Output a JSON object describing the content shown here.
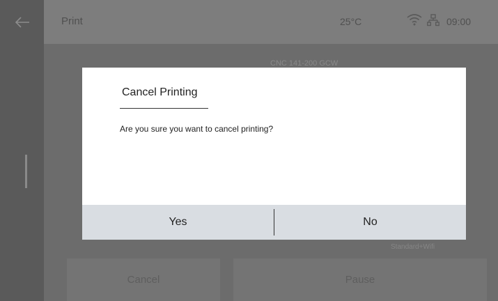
{
  "header": {
    "back_icon": "arrow-left-icon",
    "title": "Print",
    "temperature": "25°C",
    "wifi_icon": "wifi-icon",
    "network_icon": "network-icon",
    "time": "09:00"
  },
  "background": {
    "model_info": "CNC 141-200 GCW",
    "print_mode": "Standard+Wifi",
    "cancel_label": "Cancel",
    "pause_label": "Pause"
  },
  "dialog": {
    "title": "Cancel Printing",
    "message": "Are you sure you want to cancel printing?",
    "yes_label": "Yes",
    "no_label": "No"
  },
  "colors": {
    "dialog_background": "#ffffff",
    "dialog_button_bar": "#d9dde2",
    "overlay_dark": "#5a5a5a"
  }
}
